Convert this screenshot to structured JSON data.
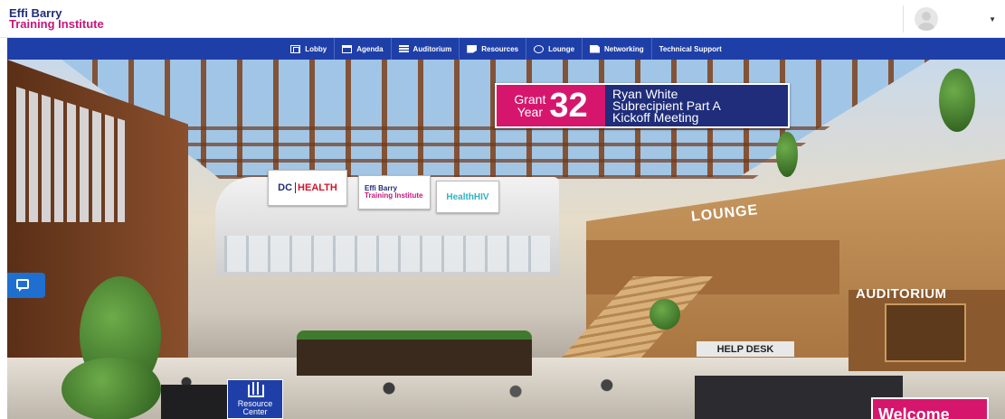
{
  "header": {
    "logo_line1": "Effi Barry",
    "logo_line2": "Training Institute"
  },
  "nav": {
    "items": [
      {
        "label": "Lobby",
        "icon": "lobby-icon"
      },
      {
        "label": "Agenda",
        "icon": "agenda-icon"
      },
      {
        "label": "Auditorium",
        "icon": "list-icon"
      },
      {
        "label": "Resources",
        "icon": "document-icon"
      },
      {
        "label": "Lounge",
        "icon": "chat-bubbles-icon"
      },
      {
        "label": "Networking",
        "icon": "file-icon"
      },
      {
        "label": "Technical Support",
        "icon": ""
      }
    ]
  },
  "scene": {
    "grant_sign": {
      "word1": "Grant",
      "word2": "Year",
      "number": "32",
      "line1": "Ryan White",
      "line2": "Subrecipient Part A",
      "line3": "Kickoff Meeting"
    },
    "sponsors": {
      "dc_prefix": "DC",
      "dc_health": "HEALTH",
      "effi_line1": "Effi Barry",
      "effi_line2": "Training Institute",
      "healthhiv": "HealthHIV"
    },
    "lounge_label": "LOUNGE",
    "auditorium_label": "AUDITORIUM",
    "help_desk_label": "HELP DESK",
    "resource_center_line1": "Resource",
    "resource_center_line2": "Center",
    "welcome_label": "Welcome"
  },
  "colors": {
    "nav_bg": "#1f3fa8",
    "brand_pink": "#d6166d",
    "brand_navy": "#1f2d7a",
    "chat_blue": "#1f6fd0"
  }
}
